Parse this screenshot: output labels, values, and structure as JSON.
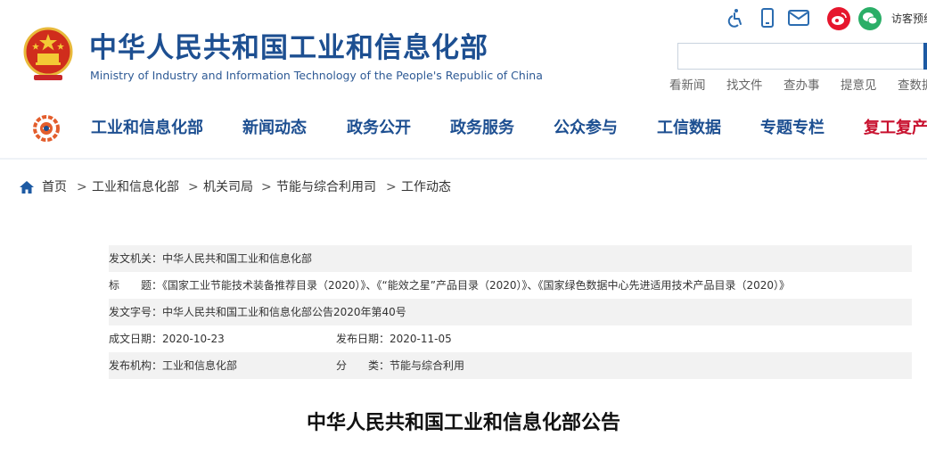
{
  "header": {
    "title_cn": "中华人民共和国工业和信息化部",
    "title_en": "Ministry of Industry and Information Technology of the People's Republic of China",
    "utilities": [
      {
        "icon": "accessibility-icon"
      },
      {
        "icon": "mobile-icon"
      },
      {
        "icon": "mail-icon"
      }
    ],
    "social": [
      {
        "icon": "weibo-icon",
        "color": "#e6162d"
      },
      {
        "icon": "wechat-icon",
        "color": "#2aae67"
      }
    ],
    "visitor_label": "访客预约",
    "search": {
      "value": "",
      "placeholder": ""
    },
    "quick_links": [
      "看新闻",
      "找文件",
      "查办事",
      "提意见",
      "查数据"
    ]
  },
  "nav": {
    "items": [
      "工业和信息化部",
      "新闻动态",
      "政务公开",
      "政务服务",
      "公众参与",
      "工信数据",
      "专题专栏",
      "复工复产"
    ],
    "colors": {
      "primary": "#1d4f91",
      "highlight": "#c8102e"
    }
  },
  "breadcrumb": {
    "items": [
      "首页",
      "工业和信息化部",
      "机关司局",
      "节能与综合利用司",
      "工作动态"
    ],
    "separator": ">"
  },
  "info": {
    "issuer": "发文机关：中华人民共和国工业和信息化部",
    "title": "标　　题：《国家工业节能技术装备推荐目录（2020）》、《“能效之星”产品目录（2020）》、《国家绿色数据中心先进适用技术产品目录（2020）》",
    "doc_no": "发文字号：中华人民共和国工业和信息化部公告2020年第40号",
    "created": "成文日期：2020-10-23",
    "published": "发布日期：2020-11-05",
    "publisher": "发布机构：工业和信息化部",
    "category": "分　　类：节能与综合利用"
  },
  "article": {
    "title": "中华人民共和国工业和信息化部公告"
  }
}
